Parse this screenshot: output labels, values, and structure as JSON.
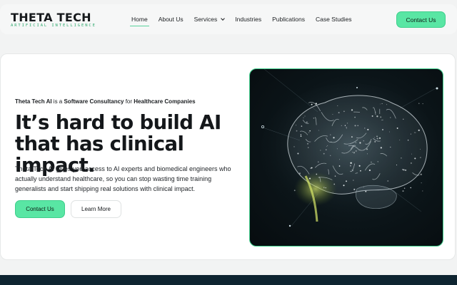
{
  "brand": {
    "name": "THETA TECH",
    "subtitle": "ARTIFICIAL INTELLIGENCE",
    "accent": "#59e6a4"
  },
  "nav": {
    "items": [
      {
        "label": "Home",
        "active": true
      },
      {
        "label": "About Us"
      },
      {
        "label": "Services",
        "icon": "chevron-down-icon"
      },
      {
        "label": "Industries"
      },
      {
        "label": "Publications"
      },
      {
        "label": "Case Studies"
      }
    ],
    "cta_label": "Contact Us"
  },
  "hero": {
    "tagline_a": "Theta Tech AI",
    "tagline_b": " is a ",
    "tagline_c": "Software Consultancy",
    "tagline_d": " for ",
    "tagline_e": "Healthcare Companies",
    "headline": "It’s hard to build AI that has clinical impact.",
    "paragraph": "Theta Tech AI gives you access to AI experts and biomedical engineers who actually understand healthcare, so you can stop wasting time training generalists and start shipping real solutions with clinical impact.",
    "primary_label": "Contact Us",
    "secondary_label": "Learn More",
    "image": "glowing-brain-network"
  }
}
